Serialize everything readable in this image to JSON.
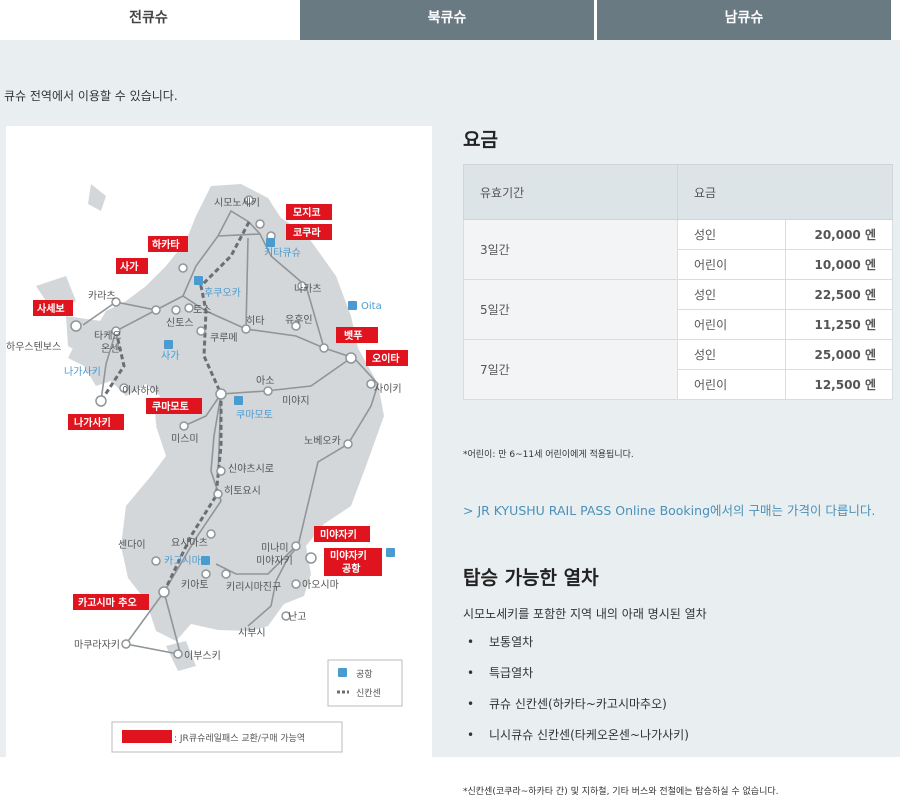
{
  "tabs": [
    "전큐슈",
    "북큐슈",
    "남큐슈"
  ],
  "intro": "큐슈 전역에서 이용할 수 있습니다.",
  "map": {
    "highlight_stations": [
      "모지코",
      "코쿠라",
      "하카타",
      "사가",
      "사세보",
      "벳푸",
      "오이타",
      "쿠마모토",
      "나가사키",
      "미야자키",
      "미야자키 공항",
      "카고시마 추오"
    ],
    "stations": [
      "시모노세키",
      "키타큐슈",
      "나카츠",
      "후쿠오카",
      "카라츠",
      "토스",
      "신토스",
      "타케오",
      "온센",
      "하우스텐보스",
      "쿠루메",
      "히타",
      "유후인",
      "Oita",
      "사가",
      "나가사키",
      "이사하야",
      "아소",
      "미야지",
      "사이키",
      "쿠마모토",
      "미스미",
      "노베오카",
      "신야츠시로",
      "히토요시",
      "요시마츠",
      "카고시마",
      "미나미 미야자키",
      "센다이",
      "키리시마진구",
      "아오시마",
      "난고",
      "시부시",
      "마쿠라자키",
      "이부스키",
      "키아토"
    ],
    "legend": {
      "airport": "공항",
      "shinkansen": "신칸센",
      "pass_station": ": JR큐슈레일패스 교환/구매 가능역"
    },
    "colors": {
      "highlight": "#e0141e",
      "land": "#d4d7d9",
      "line": "#999999",
      "accent": "#4a9bd0"
    }
  },
  "fares": {
    "title": "요금",
    "headers": [
      "유효기간",
      "요금"
    ],
    "rows": [
      {
        "period": "3일간",
        "items": [
          {
            "kind": "성인",
            "price": "20,000 엔"
          },
          {
            "kind": "어린이",
            "price": "10,000 엔"
          }
        ]
      },
      {
        "period": "5일간",
        "items": [
          {
            "kind": "성인",
            "price": "22,500 엔"
          },
          {
            "kind": "어린이",
            "price": "11,250 엔"
          }
        ]
      },
      {
        "period": "7일간",
        "items": [
          {
            "kind": "성인",
            "price": "25,000 엔"
          },
          {
            "kind": "어린이",
            "price": "12,500 엔"
          }
        ]
      }
    ],
    "note": "*어린이: 만 6~11세 어린이에게 적용됩니다."
  },
  "booking_link": "> JR KYUSHU RAIL PASS Online Booking에서의 구매는 가격이 다릅니다.",
  "trains": {
    "title": "탑승 가능한 열차",
    "desc": "시모노세키를 포함한 지역 내의 아래 명시된 열차",
    "items": [
      "보통열차",
      "특급열차",
      "큐슈 신칸센(하카타~카고시마추오)",
      "니시큐슈 신칸센(타케오온센~나가사키)"
    ],
    "note": "*신칸센(코쿠라~하카타 간) 및 지하철, 기타 버스와 전철에는 탑승하실 수 없습니다."
  }
}
